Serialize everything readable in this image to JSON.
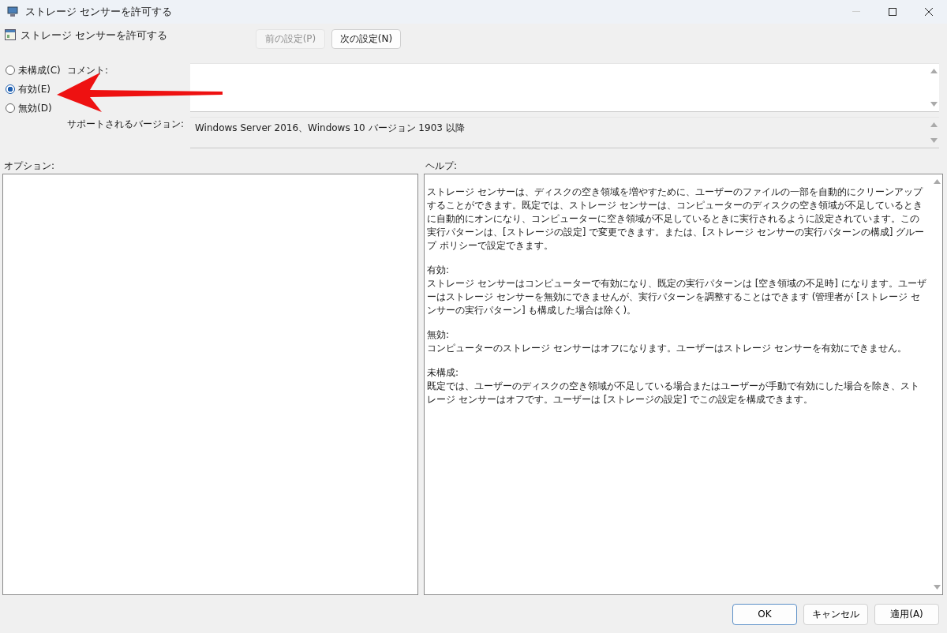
{
  "window": {
    "title": "ストレージ センサーを許可する"
  },
  "policy": {
    "title": "ストレージ センサーを許可する"
  },
  "nav_buttons": [
    {
      "label": "前の設定(P)",
      "disabled": true
    },
    {
      "label": "次の設定(N)",
      "disabled": false
    }
  ],
  "states": [
    {
      "label": "未構成(C)",
      "selected": false
    },
    {
      "label": "有効(E)",
      "selected": true
    },
    {
      "label": "無効(D)",
      "selected": false
    }
  ],
  "comment": {
    "label": "コメント:"
  },
  "supported": {
    "label": "サポートされるバージョン:",
    "value": "Windows Server 2016、Windows 10 バージョン 1903 以降"
  },
  "options": {
    "label": "オプション:"
  },
  "help": {
    "label": "ヘルプ:",
    "sections": [
      {
        "text": "ストレージ センサーは、ディスクの空き領域を増やすために、ユーザーのファイルの一部を自動的にクリーンアップすることができます。既定では、ストレージ センサーは、コンピューターのディスクの空き領域が不足しているときに自動的にオンになり、コンピューターに空き領域が不足しているときに実行されるように設定されています。この実行パターンは、[ストレージの設定] で変更できます。または、[ストレージ センサーの実行パターンの構成] グループ ポリシーで設定できます。"
      },
      {
        "heading": "有効:",
        "text": "ストレージ センサーはコンピューターで有効になり、既定の実行パターンは [空き領域の不足時] になります。ユーザーはストレージ センサーを無効にできませんが、実行パターンを調整することはできます (管理者が [ストレージ センサーの実行パターン] も構成した場合は除く)。"
      },
      {
        "heading": "無効:",
        "text": "コンピューターのストレージ センサーはオフになります。ユーザーはストレージ センサーを有効にできません。"
      },
      {
        "heading": "未構成:",
        "text": "既定では、ユーザーのディスクの空き領域が不足している場合またはユーザーが手動で有効にした場合を除き、ストレージ センサーはオフです。ユーザーは [ストレージの設定] でこの設定を構成できます。"
      }
    ]
  },
  "buttons": [
    {
      "label": "OK",
      "default": true
    },
    {
      "label": "キャンセル",
      "default": false
    },
    {
      "label": "適用(A)",
      "default": false
    }
  ]
}
